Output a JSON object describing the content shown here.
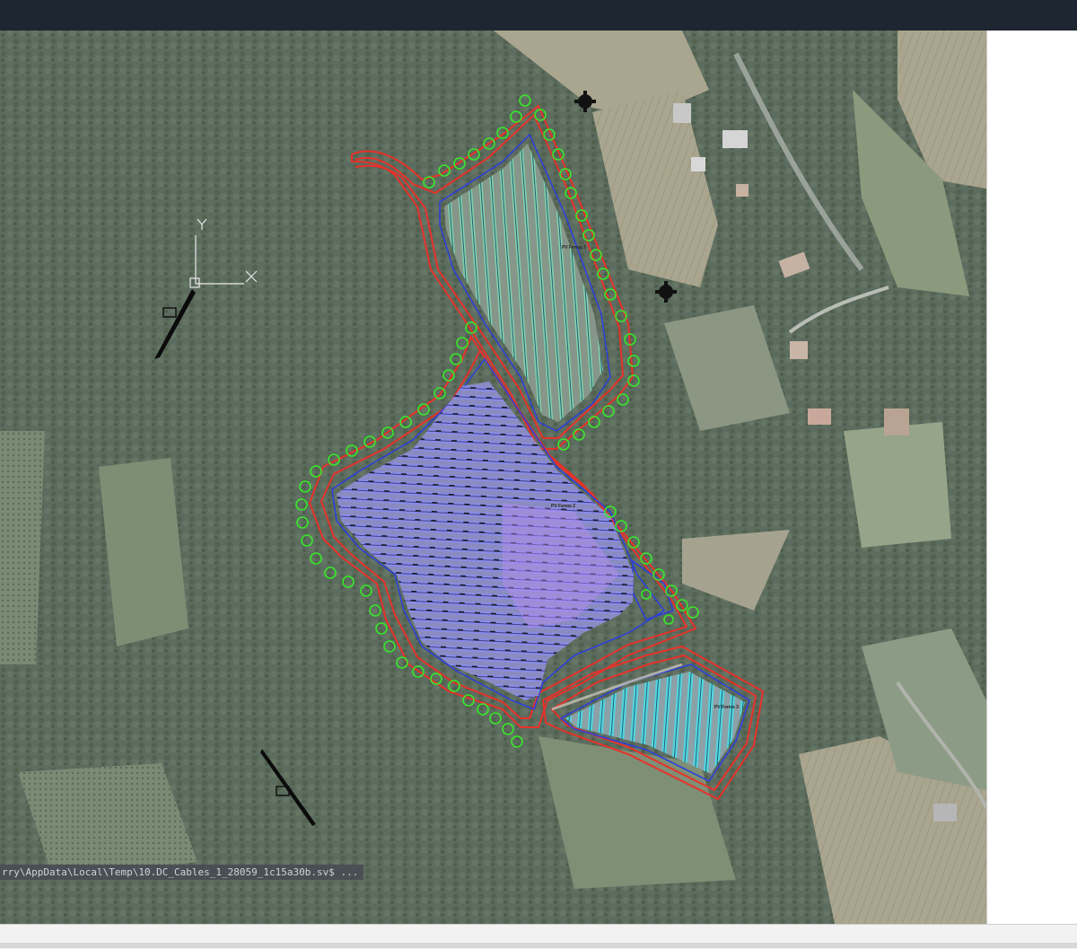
{
  "command_tooltip": {
    "text": "rry\\AppData\\Local\\Temp\\10.DC_Cables_1_28059_1c15a30b.sv$ ..."
  },
  "ucs": {
    "x_label": "X",
    "y_label": "Y"
  },
  "phase_labels": {
    "phase3": "PV Fenos 3",
    "phase2": "PV Fenos 2",
    "phase1": "PV Fenos 3"
  },
  "colors": {
    "boundary": "#e6322a",
    "fence": "#2b3de0",
    "trees": "#38e82a",
    "panels_north": "#6fd3a0",
    "panels_center": "#7b7ff2",
    "panels_south": "#3fd6e0",
    "titlebar": "#1e2631"
  }
}
